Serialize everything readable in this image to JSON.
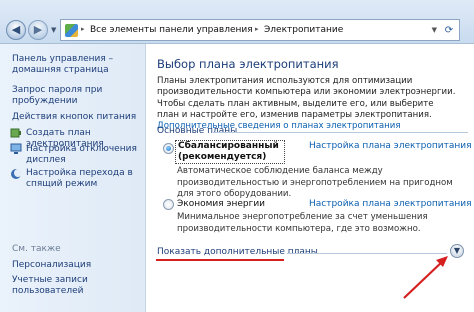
{
  "breadcrumb": {
    "items": [
      "Все элементы панели управления",
      "Электропитание"
    ]
  },
  "sidebar": {
    "items": [
      "Панель управления – домашняя страница",
      "Запрос пароля при пробуждении",
      "Действия кнопок питания",
      "Создать план электропитания",
      "Настройка отключения дисплея",
      "Настройка перехода в спящий режим"
    ],
    "see_also_label": "См. также",
    "see_also": [
      "Персонализация",
      "Учетные записи пользователей"
    ]
  },
  "main": {
    "title": "Выбор плана электропитания",
    "description": "Планы электропитания используются для оптимизации производительности компьютера или экономии электроэнергии. Чтобы сделать план активным, выделите его, или выберите план и настройте его, изменив параметры электропитания.",
    "description_link": "Дополнительные сведения о планах электропитания",
    "section_title": "Основные планы",
    "plans": [
      {
        "name": "Сбалансированный (рекомендуется)",
        "link": "Настройка плана электропитания",
        "desc": "Автоматическое соблюдение баланса между производительностью и энергопотреблением на пригодном для этого оборудовании.",
        "selected": true
      },
      {
        "name": "Экономия энергии",
        "link": "Настройка плана электропитания",
        "desc": "Минимальное энергопотребление за счет уменьшения производительности компьютера, где это возможно.",
        "selected": false
      }
    ],
    "show_more": "Показать дополнительные планы"
  },
  "colors": {
    "link": "#0b5fb0",
    "heading": "#1c3d78",
    "annotation": "#d61f1f"
  }
}
